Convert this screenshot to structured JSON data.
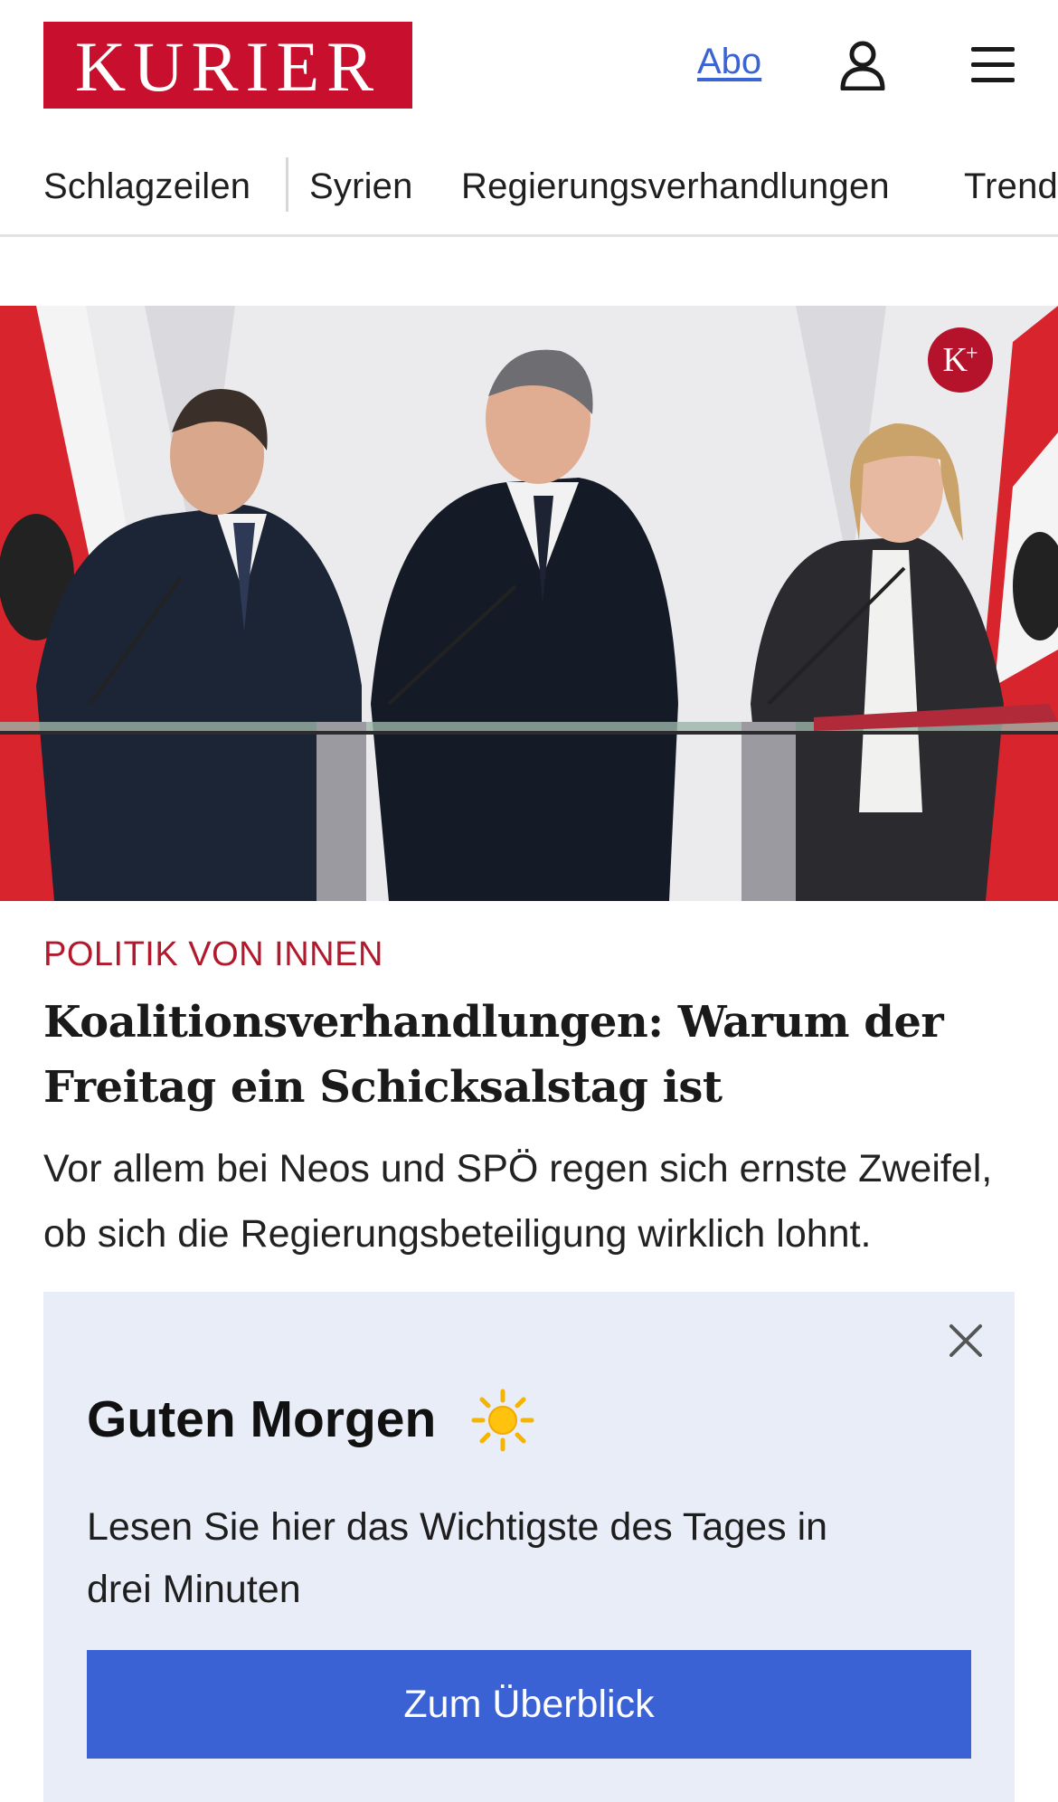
{
  "header": {
    "logo_text": "KURIER",
    "abo_label": "Abo",
    "icons": [
      "user-icon",
      "menu-icon"
    ]
  },
  "nav": {
    "items": [
      {
        "label": "Schlagzeilen"
      },
      {
        "label": "Syrien"
      },
      {
        "label": "Regierungsverhandlungen"
      },
      {
        "label": "Trends"
      }
    ]
  },
  "article": {
    "badge": "K",
    "kicker": "POLITIK VON INNEN",
    "headline": "Koalitionsverhandlungen: Warum der Freitag ein Schicksalstag ist",
    "teaser": "Vor allem bei Neos und SPÖ regen sich ernste Zweifel, ob sich die Regierungsbeteiligung wirklich lohnt."
  },
  "popup": {
    "title": "Guten Morgen",
    "body": "Lesen Sie hier das Wichtigste des Tages in drei Minuten",
    "button": "Zum Überblick"
  },
  "colors": {
    "brand_red": "#c8102e",
    "link_blue": "#3a63d3",
    "button_blue": "#3b62d4",
    "popup_bg": "#e9edf7"
  }
}
